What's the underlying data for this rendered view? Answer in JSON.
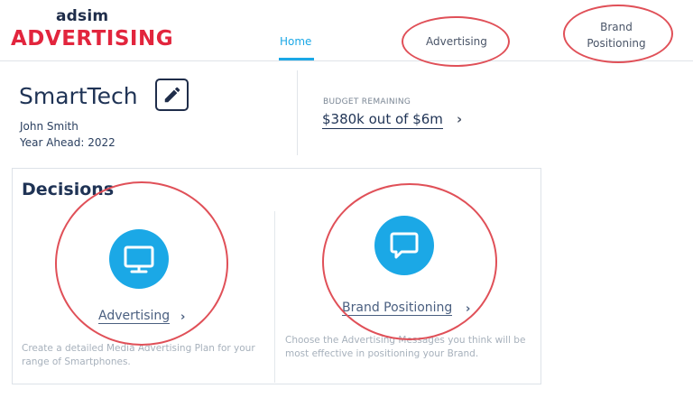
{
  "logo": {
    "top": "adsim",
    "main": "ADVERTISING"
  },
  "nav": {
    "home": "Home",
    "advertising": "Advertising",
    "brand_line1": "Brand",
    "brand_line2": "Positioning"
  },
  "company": {
    "name": "SmartTech",
    "user": "John Smith",
    "year": "Year Ahead: 2022"
  },
  "budget": {
    "label": "BUDGET REMAINING",
    "value": "$380k out of $6m",
    "chevron": "›"
  },
  "decisions": {
    "title": "Decisions",
    "cards": [
      {
        "icon": "monitor-icon",
        "label": "Advertising",
        "chevron": "›",
        "description": "Create a detailed Media Advertising Plan for your range of Smartphones."
      },
      {
        "icon": "chat-bubble-icon",
        "label": "Brand Positioning",
        "chevron": "›",
        "description": "Choose the Advertising Messages you think will be most effective in positioning your Brand."
      }
    ]
  },
  "colors": {
    "accent": "#1ba8e6",
    "brand_red": "#e2253d",
    "navy": "#1f3355",
    "annotation_red": "#e05058"
  }
}
